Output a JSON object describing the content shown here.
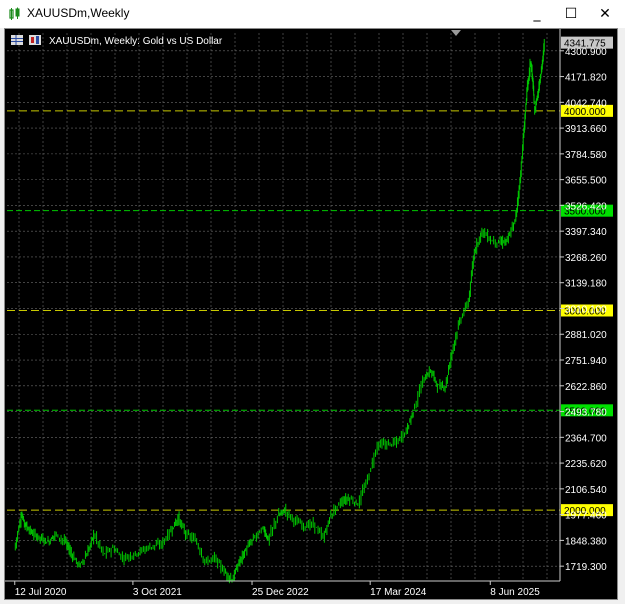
{
  "window": {
    "title": "XAUUSDm,Weekly",
    "minimize_glyph": "_",
    "maximize_glyph": "☐",
    "close_glyph": "✕"
  },
  "chart_header": {
    "symbol_text": "XAUUSDm, Weekly:  Gold vs US Dollar"
  },
  "colors": {
    "background": "#000000",
    "grid": "#6b6b6b",
    "candle": "#00c800",
    "level_yellow": "#c8c800",
    "level_green": "#00c800",
    "price_label_bg": "#c8c8c8",
    "axis_text": "#ffffff"
  },
  "chart_data": {
    "type": "candlestick",
    "symbol": "XAUUSDm",
    "timeframe": "Weekly",
    "current_price": "4341.775",
    "y_axis_ticks": [
      "4300.900",
      "4171.820",
      "4042.740",
      "3913.660",
      "3784.580",
      "3655.500",
      "3526.420",
      "3397.340",
      "3268.260",
      "3139.180",
      "3010.100",
      "2881.020",
      "2751.940",
      "2622.860",
      "2493.780",
      "2364.700",
      "2235.620",
      "2106.540",
      "1977.460",
      "1848.380",
      "1719.300"
    ],
    "x_axis_ticks": [
      "12 Jul 2020",
      "3 Oct 2021",
      "25 Dec 2022",
      "17 Mar 2024",
      "8 Jun 2025"
    ],
    "levels": [
      {
        "price": 4000,
        "label": "4000.000",
        "color": "yellow"
      },
      {
        "price": 3500,
        "label": "3500.000",
        "color": "green"
      },
      {
        "price": 3000,
        "label": "3000.000",
        "color": "yellow"
      },
      {
        "price": 2500,
        "label": "2500.000",
        "color": "green"
      },
      {
        "price": 2000,
        "label": "2000.000",
        "color": "yellow"
      }
    ],
    "ylim": [
      1645,
      4390
    ],
    "close_series": [
      [
        2020.53,
        1805
      ],
      [
        2020.6,
        1975
      ],
      [
        2020.65,
        1920
      ],
      [
        2020.72,
        1880
      ],
      [
        2020.8,
        1860
      ],
      [
        2020.88,
        1840
      ],
      [
        2020.95,
        1880
      ],
      [
        2021.05,
        1845
      ],
      [
        2021.12,
        1780
      ],
      [
        2021.2,
        1720
      ],
      [
        2021.28,
        1780
      ],
      [
        2021.35,
        1880
      ],
      [
        2021.45,
        1780
      ],
      [
        2021.55,
        1810
      ],
      [
        2021.65,
        1760
      ],
      [
        2021.75,
        1775
      ],
      [
        2021.85,
        1800
      ],
      [
        2021.95,
        1820
      ],
      [
        2022.05,
        1830
      ],
      [
        2022.15,
        1900
      ],
      [
        2022.22,
        1960
      ],
      [
        2022.3,
        1880
      ],
      [
        2022.4,
        1850
      ],
      [
        2022.5,
        1740
      ],
      [
        2022.6,
        1760
      ],
      [
        2022.7,
        1690
      ],
      [
        2022.78,
        1650
      ],
      [
        2022.85,
        1740
      ],
      [
        2022.92,
        1800
      ],
      [
        2023.0,
        1860
      ],
      [
        2023.1,
        1910
      ],
      [
        2023.15,
        1850
      ],
      [
        2023.25,
        1970
      ],
      [
        2023.32,
        2000
      ],
      [
        2023.42,
        1950
      ],
      [
        2023.52,
        1920
      ],
      [
        2023.62,
        1930
      ],
      [
        2023.72,
        1860
      ],
      [
        2023.8,
        1980
      ],
      [
        2023.9,
        2040
      ],
      [
        2023.98,
        2060
      ],
      [
        2024.08,
        2030
      ],
      [
        2024.18,
        2160
      ],
      [
        2024.28,
        2330
      ],
      [
        2024.38,
        2330
      ],
      [
        2024.48,
        2340
      ],
      [
        2024.58,
        2400
      ],
      [
        2024.65,
        2500
      ],
      [
        2024.75,
        2650
      ],
      [
        2024.83,
        2700
      ],
      [
        2024.9,
        2620
      ],
      [
        2024.98,
        2620
      ],
      [
        2025.05,
        2800
      ],
      [
        2025.13,
        2950
      ],
      [
        2025.22,
        3050
      ],
      [
        2025.28,
        3300
      ],
      [
        2025.36,
        3400
      ],
      [
        2025.45,
        3350
      ],
      [
        2025.55,
        3340
      ],
      [
        2025.62,
        3350
      ],
      [
        2025.7,
        3450
      ],
      [
        2025.75,
        3650
      ],
      [
        2025.79,
        3900
      ],
      [
        2025.82,
        4100
      ],
      [
        2025.86,
        4250
      ],
      [
        2025.88,
        4150
      ],
      [
        2025.9,
        4000
      ],
      [
        2025.94,
        4100
      ],
      [
        2025.97,
        4200
      ],
      [
        2026.0,
        4341.775
      ]
    ]
  }
}
